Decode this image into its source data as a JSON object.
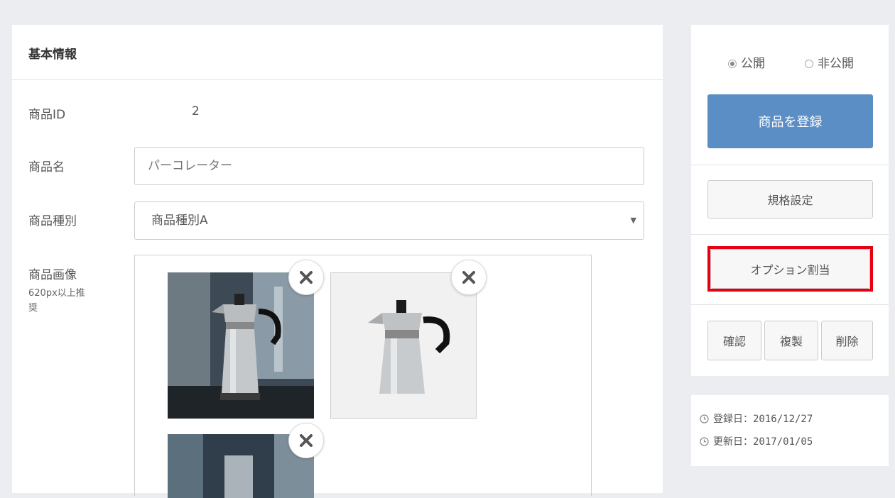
{
  "basic_info": {
    "title": "基本情報",
    "product_id_label": "商品ID",
    "product_id_value": "2",
    "product_name_label": "商品名",
    "product_name_placeholder": "パーコレーター",
    "product_type_label": "商品種別",
    "product_type_value": "商品種別A",
    "product_image_label": "商品画像",
    "product_image_hint": "620px以上推奨"
  },
  "images": [
    {
      "icon": "close-icon"
    },
    {
      "icon": "close-icon"
    },
    {
      "icon": "close-icon"
    }
  ],
  "status": {
    "public_label": "公開",
    "private_label": "非公開",
    "selected": "public"
  },
  "actions": {
    "register_label": "商品を登録",
    "spec_label": "規格設定",
    "option_label": "オプション割当",
    "confirm_label": "確認",
    "duplicate_label": "複製",
    "delete_label": "削除"
  },
  "dates": {
    "created_label": "登録日：2016/12/27",
    "updated_label": "更新日：2017/01/05"
  },
  "colors": {
    "primary": "#5b8ec5",
    "highlight": "#e60012"
  }
}
